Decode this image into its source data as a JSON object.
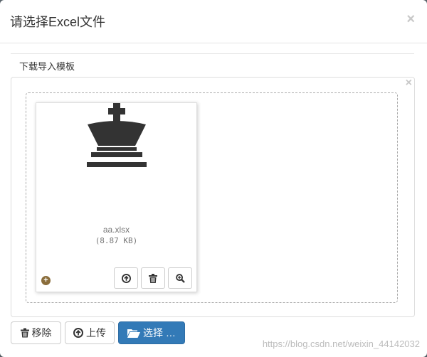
{
  "dialog": {
    "title": "请选择Excel文件",
    "close_glyph": "×"
  },
  "template_link": "下载导入模板",
  "file_input": {
    "close_glyph": "×",
    "files": [
      {
        "name": "aa.xlsx",
        "size": "(8.87 KB)",
        "icon": "chess-king-icon"
      }
    ],
    "drag_glyph": "+",
    "file_actions": [
      {
        "name": "upload-file-button",
        "icon": "arrow-up-circle-icon"
      },
      {
        "name": "remove-file-button",
        "icon": "trash-icon"
      },
      {
        "name": "zoom-file-button",
        "icon": "zoom-in-icon"
      }
    ]
  },
  "buttons": {
    "remove": "移除",
    "upload": "上传",
    "browse": "选择 …"
  },
  "colors": {
    "primary": "#337ab7",
    "drag_handle": "#8a6d3b"
  },
  "watermark": "https://blog.csdn.net/weixin_44142032"
}
